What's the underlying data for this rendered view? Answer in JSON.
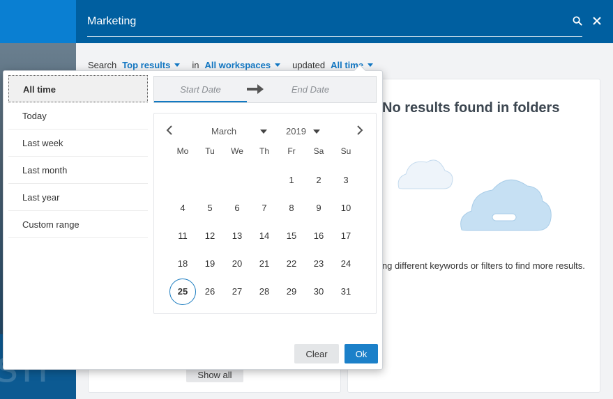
{
  "header": {
    "search_value": "Marketing",
    "search_icon": "search-icon",
    "close_icon": "close-icon"
  },
  "filter_bar": {
    "search_label": "Search",
    "scope_value": "Top results",
    "in_label": "in",
    "workspace_value": "All workspaces",
    "updated_label": "updated",
    "time_value": "All time"
  },
  "results": {
    "no_results_title": "No results found in folders",
    "no_results_hint": "ing different keywords or filters to find more results.",
    "show_all_label": "Show all"
  },
  "date_filter": {
    "ranges": [
      "All time",
      "Today",
      "Last week",
      "Last month",
      "Last year",
      "Custom range"
    ],
    "selected_range": "All time",
    "start_placeholder": "Start Date",
    "end_placeholder": "End Date",
    "calendar": {
      "month": "March",
      "year": "2019",
      "weekdays": [
        "Mo",
        "Tu",
        "We",
        "Th",
        "Fr",
        "Sa",
        "Su"
      ],
      "first_weekday_index": 4,
      "days_in_month": 31,
      "today": 25
    },
    "clear_label": "Clear",
    "ok_label": "Ok"
  },
  "colors": {
    "header_bg": "#005fa0",
    "accent": "#1277c3",
    "ok_button": "#1b80c9"
  }
}
